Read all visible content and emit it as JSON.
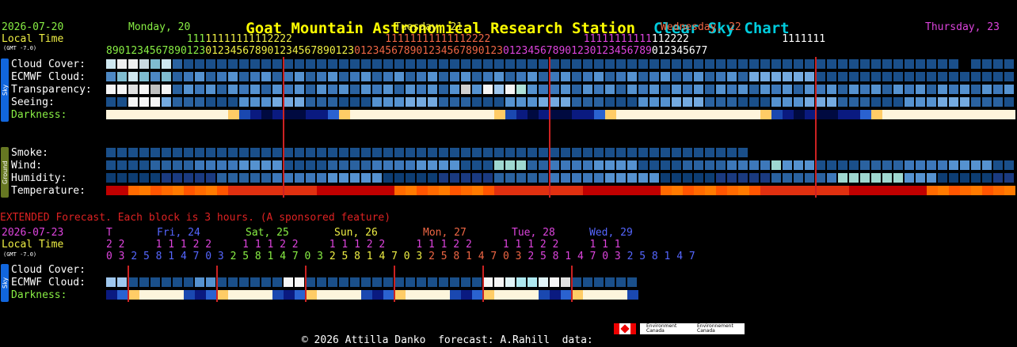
{
  "title": {
    "station": "Goat Mountain Astronomical Research Station",
    "chart": "Clear Sky Chart"
  },
  "header": {
    "date": "2026-07-20",
    "local_time": "Local Time",
    "gmt": "(GMT -7.0)",
    "days": [
      {
        "label": "Monday, 20",
        "color": "#88ee44"
      },
      {
        "label": "Tuesday, 21",
        "color": "#eeee44"
      },
      {
        "label": "Wednesday, 22",
        "color": "#ee6644"
      },
      {
        "label": "Thursday, 23",
        "color": "#dd44dd"
      }
    ],
    "hours_tens": "             11111111111112222               11111111111112222               11111111111112222               1111111",
    "hours_ones": "8901234567890123012345678901234567890123012345678901234567890123012345678901230123456789012345677"
  },
  "sky_panel": {
    "label": "Sky"
  },
  "ground_panel": {
    "label": "Ground"
  },
  "rows": {
    "cloud": "Cloud Cover:",
    "ecmwf": "ECMWF Cloud:",
    "transparency": "Transparency:",
    "seeing": "Seeing:",
    "darkness": "Darkness:",
    "smoke": "Smoke:",
    "wind": "Wind:",
    "humidity": "Humidity:",
    "temperature": "Temperature:"
  },
  "extended": {
    "notice": "EXTENDED Forecast. Each block is 3 hours. (A sponsored feature)",
    "date": "2026-07-23",
    "local_time": "Local Time",
    "gmt": "(GMT -7.0)",
    "days": [
      {
        "label": "T",
        "color": "#dd44dd"
      },
      {
        "label": "Fri, 24",
        "color": "#5566ff"
      },
      {
        "label": "Sat, 25",
        "color": "#88ee44"
      },
      {
        "label": "Sun, 26",
        "color": "#eeee44"
      },
      {
        "label": "Mon, 27",
        "color": "#ee6644"
      },
      {
        "label": "Tue, 28",
        "color": "#dd44dd"
      },
      {
        "label": "Wed, 29",
        "color": "#5566ff"
      }
    ],
    "hours_tens": "2 2     1 1 1 2 2     1 1 1 2 2     1 1 1 2 2     1 1 1 2 2     1 1 1 2 2     1 1 1",
    "hours_ones": "0 3 2 5 8 1 4 7 0 3 2 5 8 1 4 7 0 3 2 5 8 1 4 7 0 3 2 5 8 1 4 7 0 3 2 5 8 1 4 7 0 3 2 5 8 1 4 7",
    "rows": {
      "cloud": "Cloud Cover:",
      "ecmwf": "ECMWF Cloud:",
      "darkness": "Darkness:"
    }
  },
  "footer": {
    "text": "© 2026 Attilla Danko  forecast: A.Rahill  data:",
    "logo1": "Environment Canada",
    "logo2": "Environnement Canada"
  },
  "colors": {
    "day_line": "#cc2222",
    "sky_panel": "#1166dd",
    "ground_panel": "#667722",
    "cloud_clear": "#003f7f",
    "cloud_overcast": "#fafafa"
  }
}
